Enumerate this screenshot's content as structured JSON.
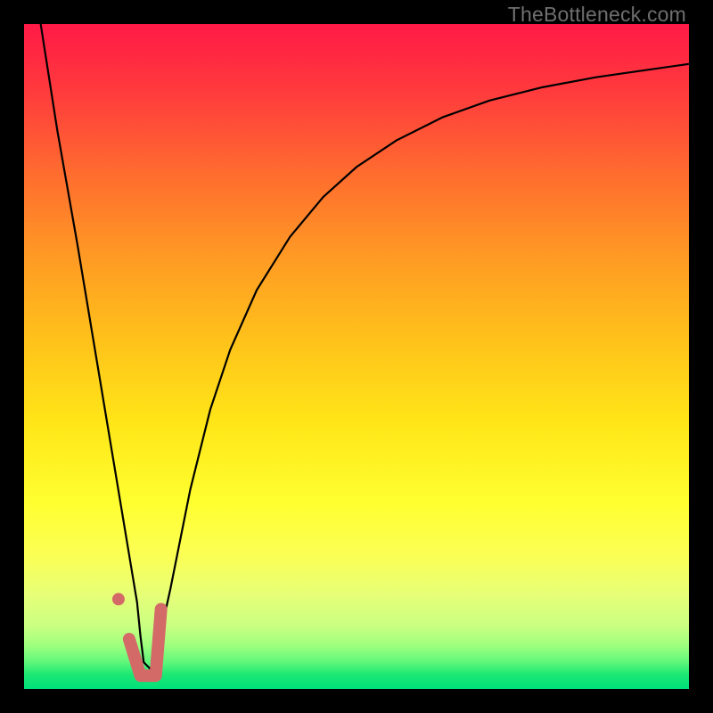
{
  "watermark": "TheBottleneck.com",
  "gradient_stops": [
    {
      "offset": 0.0,
      "color": "#ff1a46"
    },
    {
      "offset": 0.1,
      "color": "#ff3a3d"
    },
    {
      "offset": 0.22,
      "color": "#ff6a2f"
    },
    {
      "offset": 0.35,
      "color": "#ff9a24"
    },
    {
      "offset": 0.48,
      "color": "#ffc31a"
    },
    {
      "offset": 0.6,
      "color": "#ffe618"
    },
    {
      "offset": 0.72,
      "color": "#ffff30"
    },
    {
      "offset": 0.8,
      "color": "#fbff55"
    },
    {
      "offset": 0.86,
      "color": "#e6ff78"
    },
    {
      "offset": 0.905,
      "color": "#caff82"
    },
    {
      "offset": 0.935,
      "color": "#9eff7e"
    },
    {
      "offset": 0.96,
      "color": "#5ef77a"
    },
    {
      "offset": 0.978,
      "color": "#1de874"
    },
    {
      "offset": 1.0,
      "color": "#00e17a"
    }
  ],
  "chart_data": {
    "type": "line",
    "title": "",
    "xlabel": "",
    "ylabel": "",
    "x_range": [
      0,
      100
    ],
    "y_range": [
      0,
      100
    ],
    "grid": false,
    "legend": false,
    "series": [
      {
        "name": "bottleneck-curve",
        "color": "#000000",
        "stroke_width": 2.2,
        "x": [
          2.5,
          5,
          8,
          11,
          14,
          17,
          17.5,
          18,
          19,
          20,
          22,
          25,
          28,
          31,
          35,
          40,
          45,
          50,
          56,
          63,
          70,
          78,
          86,
          93,
          100
        ],
        "y": [
          100,
          84,
          67,
          49,
          31,
          13,
          8,
          4,
          3,
          6,
          15,
          30,
          42,
          51,
          60,
          68,
          74,
          78.5,
          82.5,
          86,
          88.5,
          90.5,
          92,
          93,
          94
        ]
      },
      {
        "name": "marker-stroke",
        "color": "#d46a68",
        "stroke_width": 14,
        "linecap": "round",
        "x": [
          15.8,
          17.5,
          19.8,
          20.6
        ],
        "y": [
          7.5,
          2.0,
          2.0,
          12.0
        ]
      },
      {
        "name": "marker-dot",
        "type": "scatter",
        "color": "#d46a68",
        "radius": 7,
        "x": [
          14.2
        ],
        "y": [
          13.5
        ]
      }
    ]
  }
}
